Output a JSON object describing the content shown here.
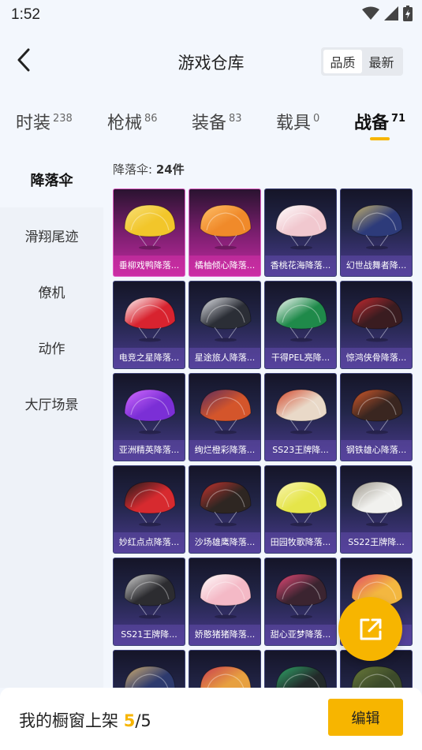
{
  "status": {
    "time": "1:52",
    "icons": [
      "wifi-icon",
      "signal-icon",
      "battery-charging-icon"
    ]
  },
  "header": {
    "title": "游戏仓库",
    "back_icon": "chevron-left-icon",
    "sort": [
      "品质",
      "最新"
    ],
    "sort_active": "品质"
  },
  "tabs": [
    {
      "label": "时装",
      "count": "238"
    },
    {
      "label": "枪械",
      "count": "86"
    },
    {
      "label": "装备",
      "count": "83"
    },
    {
      "label": "载具",
      "count": "0"
    },
    {
      "label": "战备",
      "count": "71"
    }
  ],
  "active_tab": "战备",
  "sidebar": {
    "items": [
      "降落伞",
      "滑翔尾迹",
      "僚机",
      "动作",
      "大厅场景"
    ],
    "active": "降落伞"
  },
  "section": {
    "prefix": "降落伞: ",
    "count": "24件"
  },
  "items": [
    {
      "name": "垂柳戏鸭降落...",
      "rarity": "pink",
      "colors": [
        "#f2c62a",
        "#f7e07a"
      ]
    },
    {
      "name": "橘柚倾心降落...",
      "rarity": "pink",
      "colors": [
        "#f08a2a",
        "#ffc06a"
      ]
    },
    {
      "name": "香桃花海降落...",
      "rarity": "purple",
      "colors": [
        "#f1c8cf",
        "#ffffff"
      ]
    },
    {
      "name": "幻世战舞者降...",
      "rarity": "purple",
      "colors": [
        "#2d3b7a",
        "#c9b56a"
      ]
    },
    {
      "name": "电竞之星降落...",
      "rarity": "purple",
      "colors": [
        "#d8232f",
        "#ffffff"
      ]
    },
    {
      "name": "星途旅人降落...",
      "rarity": "purple",
      "colors": [
        "#2b2e36",
        "#e7e9ee"
      ]
    },
    {
      "name": "干得PEL亮降...",
      "rarity": "purple",
      "colors": [
        "#1f8a4a",
        "#ffffff"
      ]
    },
    {
      "name": "惊鸿侠骨降落...",
      "rarity": "purple",
      "colors": [
        "#3a1c20",
        "#c82a30"
      ]
    },
    {
      "name": "亚洲精英降落...",
      "rarity": "purple",
      "colors": [
        "#7b2fd6",
        "#d36bff"
      ]
    },
    {
      "name": "绚烂橙彩降落...",
      "rarity": "purple",
      "colors": [
        "#d4552b",
        "#5a2c5e"
      ]
    },
    {
      "name": "SS23王牌降...",
      "rarity": "purple",
      "colors": [
        "#e9d9c8",
        "#d2452a"
      ]
    },
    {
      "name": "钢铁雄心降落...",
      "rarity": "purple",
      "colors": [
        "#3a2620",
        "#d55a2c"
      ]
    },
    {
      "name": "妙红点点降落...",
      "rarity": "purple",
      "colors": [
        "#d72a2f",
        "#1c1c1c"
      ]
    },
    {
      "name": "沙场雄鹰降落...",
      "rarity": "purple",
      "colors": [
        "#2e2622",
        "#c8332f"
      ]
    },
    {
      "name": "田园牧歌降落...",
      "rarity": "purple",
      "colors": [
        "#e5e54a",
        "#f9f5b5"
      ]
    },
    {
      "name": "SS22王牌降...",
      "rarity": "purple",
      "colors": [
        "#f1f1ee",
        "#9a958a"
      ]
    },
    {
      "name": "SS21王牌降...",
      "rarity": "purple",
      "colors": [
        "#2c2c30",
        "#d9d9d9"
      ]
    },
    {
      "name": "娇憨猪猪降落...",
      "rarity": "purple",
      "colors": [
        "#f4b9c6",
        "#ffffff"
      ]
    },
    {
      "name": "甜心亚梦降落...",
      "rarity": "purple",
      "colors": [
        "#3b2430",
        "#e94a79"
      ]
    },
    {
      "name": "",
      "rarity": "purple",
      "colors": [
        "#f3b740",
        "#e04a6a"
      ]
    },
    {
      "name": "",
      "rarity": "purple",
      "colors": [
        "#2d3a6e",
        "#d4b070"
      ]
    },
    {
      "name": "",
      "rarity": "purple",
      "colors": [
        "#e7a040",
        "#c83a50"
      ]
    },
    {
      "name": "",
      "rarity": "purple",
      "colors": [
        "#232a2a",
        "#2fa86a"
      ]
    },
    {
      "name": "",
      "rarity": "purple",
      "colors": [
        "#3c4a2a",
        "#6a7a3a"
      ]
    }
  ],
  "showcase": {
    "label": "我的橱窗上架 ",
    "current": "5",
    "separator": "/",
    "total": "5"
  },
  "edit_button": "编辑",
  "fab_icon": "share-external-icon",
  "accent": "#f7b500"
}
